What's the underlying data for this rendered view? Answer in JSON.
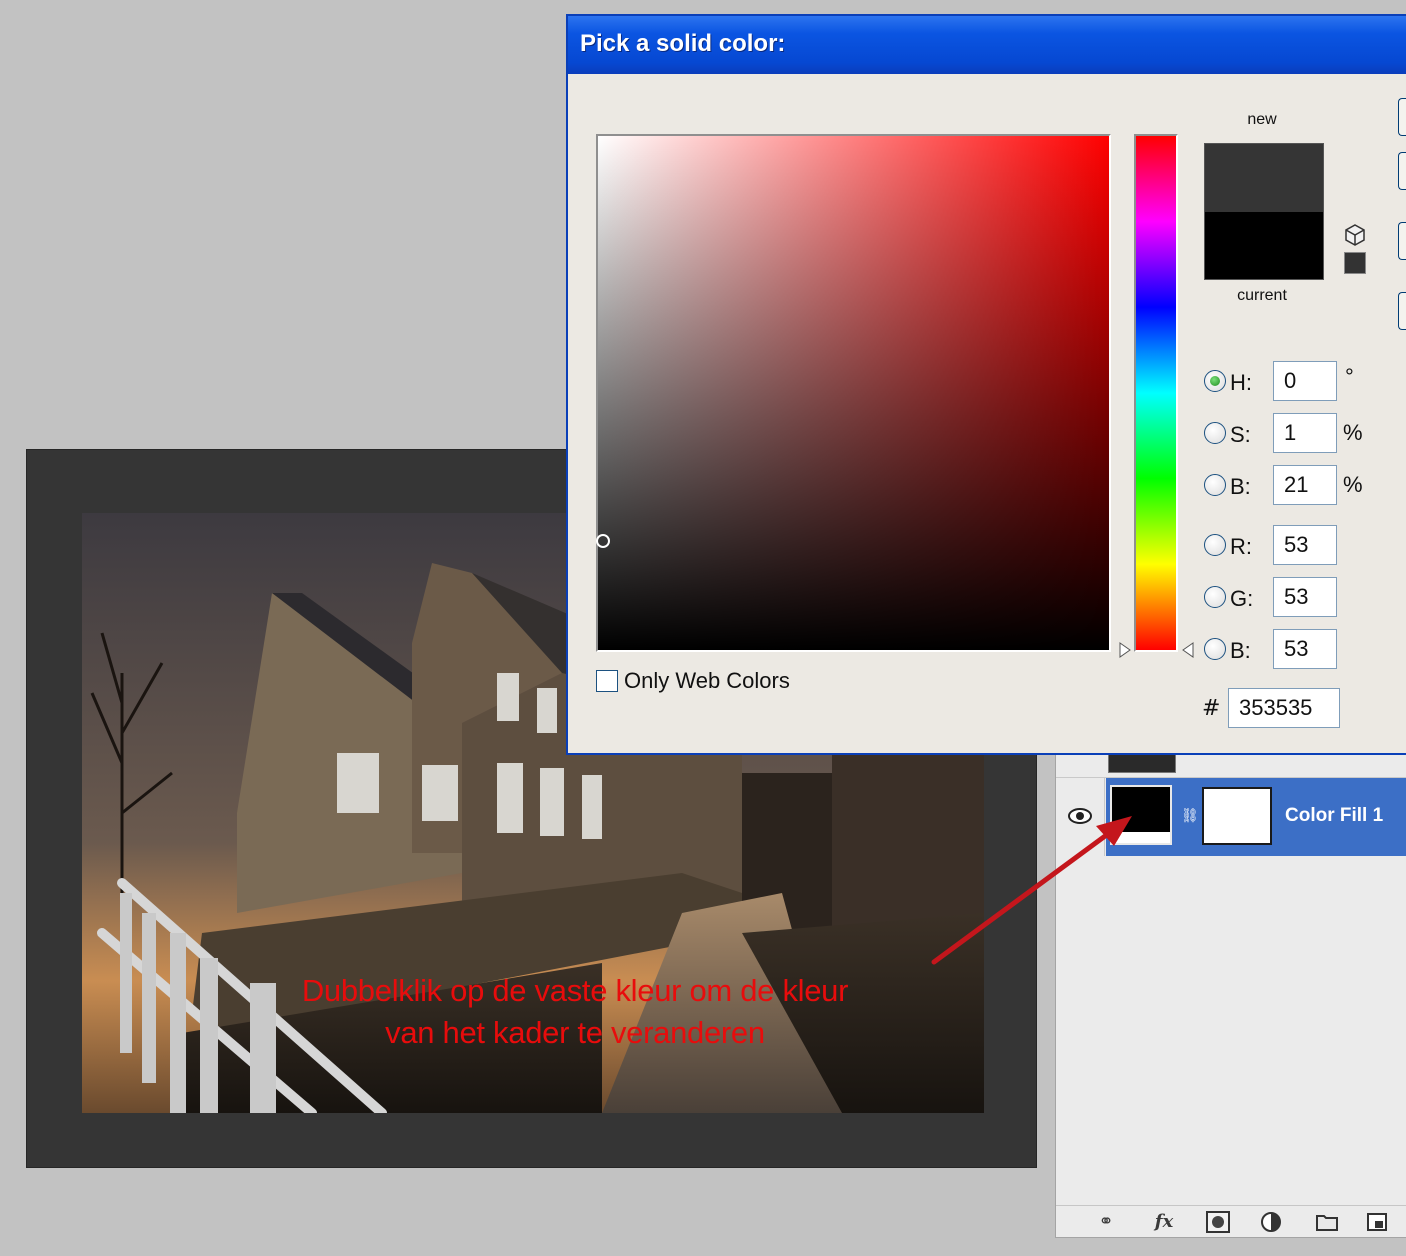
{
  "dialog": {
    "title": "Pick a solid color:",
    "new_label": "new",
    "current_label": "current",
    "new_color": "#353535",
    "current_color": "#000000",
    "only_web_colors_label": "Only Web Colors",
    "hash_label": "#",
    "hex_value": "353535",
    "fields": {
      "h": {
        "label": "H:",
        "value": "0",
        "unit": "°"
      },
      "s": {
        "label": "S:",
        "value": "1",
        "unit": "%"
      },
      "b": {
        "label": "B:",
        "value": "21",
        "unit": "%"
      },
      "r": {
        "label": "R:",
        "value": "53"
      },
      "g": {
        "label": "G:",
        "value": "53"
      },
      "bl": {
        "label": "B:",
        "value": "53"
      }
    },
    "selected_channel": "H"
  },
  "canvas": {
    "instruction_line1": "Dubbelklik op de vaste kleur om de kleur",
    "instruction_line2": "van het kader te veranderen",
    "frame_color": "#353535",
    "annotation_color": "#e80c0c"
  },
  "layers": {
    "layer_name": "Color Fill 1",
    "selection_color": "#3c6fc6",
    "footer_icons": [
      "link-icon",
      "fx-icon",
      "mask-icon",
      "adjustment-icon",
      "folder-icon",
      "new-layer-icon"
    ],
    "fx_label": "fx"
  }
}
